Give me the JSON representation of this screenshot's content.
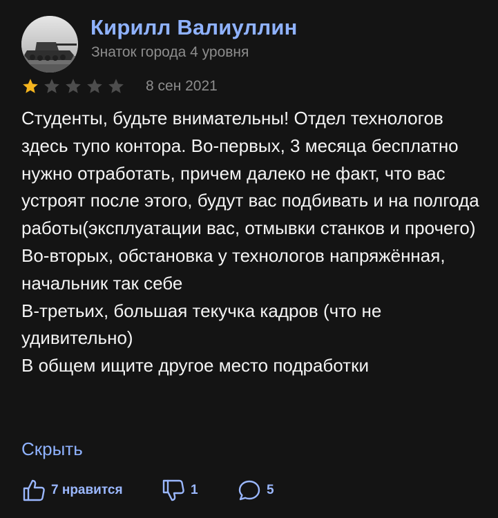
{
  "review": {
    "author_name": "Кирилл Валиуллин",
    "author_level": "Знаток города 4 уровня",
    "rating": 1,
    "max_rating": 5,
    "date": "8 сен 2021",
    "text_lines": [
      "Студенты, будьте внимательны! Отдел технологов здесь тупо контора. Во-первых, 3 месяца бесплатно нужно отработать, причем далеко не факт, что вас устроят после этого, будут вас подбивать и на полгода работы(эксплуатации вас, отмывки станков и прочего)",
      "Во-вторых, обстановка у технологов напряжённая, начальник так себе",
      "В-третьих, большая текучка кадров (что не удивительно)",
      "В общем ищите другое место подработки"
    ],
    "collapse_label": "Скрыть"
  },
  "actions": {
    "like_label": "7 нравится",
    "dislike_count": "1",
    "comment_count": "5"
  },
  "colors": {
    "background": "#141414",
    "name_accent": "#8fb2ff",
    "star_filled": "#f5b51f",
    "star_empty": "#4d4d4d",
    "secondary_text": "#8d8d8d"
  },
  "icons": {
    "avatar": "tank-photo-avatar",
    "like": "thumbs-up-icon",
    "dislike": "thumbs-down-icon",
    "comment": "comment-bubble-icon",
    "star": "star-icon"
  }
}
